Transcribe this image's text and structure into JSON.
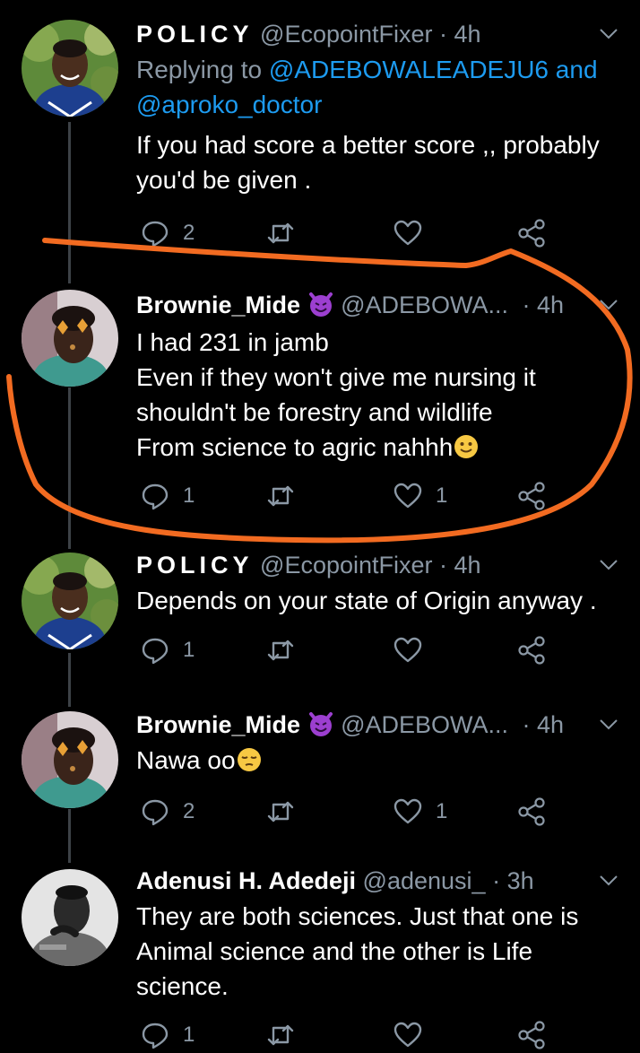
{
  "tweets": [
    {
      "name": "POLICY",
      "handle": "@EcopointFixer",
      "time": "· 4h",
      "reply_prefix": "Replying to ",
      "reply_mention_1": "@ADEBOWALEADEJU6",
      "reply_joiner": " and",
      "reply_mention_2": "@aproko_doctor",
      "lines": [
        "If you had score a better score ,, probably",
        "you'd be given ."
      ],
      "replies": "2",
      "retweets": "",
      "likes": ""
    },
    {
      "name": "Brownie_Mide",
      "handle": "@ADEBOWA...",
      "time": "· 4h",
      "lines": [
        "I had 231 in jamb",
        "Even if they won't give me nursing it",
        "shouldn't be forestry and wildlife",
        "From science to agric nahhh"
      ],
      "trailing_emoji": "slightly-smiling-face",
      "name_emoji": "smiling-face-with-horns",
      "replies": "1",
      "retweets": "",
      "likes": "1"
    },
    {
      "name": "POLICY",
      "handle": "@EcopointFixer",
      "time": "· 4h",
      "lines": [
        "Depends on your state of Origin anyway ."
      ],
      "replies": "1",
      "retweets": "",
      "likes": ""
    },
    {
      "name": "Brownie_Mide",
      "handle": "@ADEBOWA...",
      "time": "· 4h",
      "lines": [
        "Nawa oo"
      ],
      "trailing_emoji": "pensive-face",
      "name_emoji": "smiling-face-with-horns",
      "replies": "2",
      "retweets": "",
      "likes": "1"
    },
    {
      "name": "Adenusi H. Adedeji",
      "handle": "@adenusi_",
      "time": "· 3h",
      "lines": [
        "They are both sciences. Just that one is",
        "Animal science and the other is Life",
        "science."
      ],
      "replies": "1",
      "retweets": "",
      "likes": ""
    }
  ],
  "colors": {
    "background": "#000000",
    "text": "#ffffff",
    "muted": "#8b98a5",
    "link": "#1d9bf0",
    "annotation": "#f26b21"
  },
  "annotation": "hand-drawn-orange-circle-around-second-tweet"
}
